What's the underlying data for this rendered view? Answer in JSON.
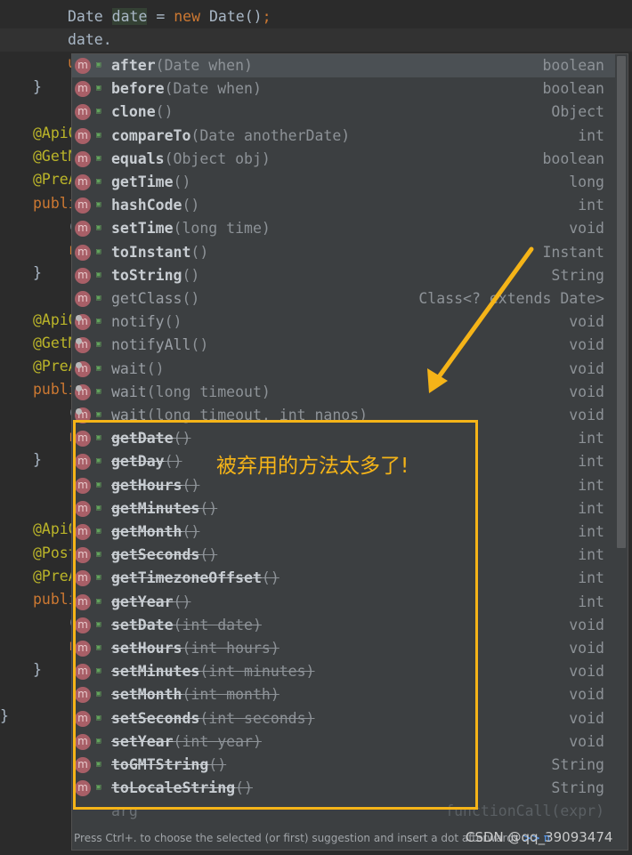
{
  "editor": {
    "lines": [
      {
        "indent": 76,
        "text": "Date date = new Date();",
        "style": "code"
      },
      {
        "indent": 76,
        "text": "date.",
        "style": "code"
      },
      {
        "indent": 76,
        "text": "u",
        "style": "kw"
      },
      {
        "indent": 37,
        "text": "}",
        "style": "code"
      },
      {
        "indent": 37,
        "text": "",
        "style": "code"
      },
      {
        "indent": 37,
        "text": "@ApiO",
        "style": "ann"
      },
      {
        "indent": 37,
        "text": "@GetM",
        "style": "ann"
      },
      {
        "indent": 37,
        "text": "@PreA",
        "style": "ann"
      },
      {
        "indent": 37,
        "text": "publi",
        "style": "kw"
      },
      {
        "indent": 76,
        "text": "(",
        "style": "code"
      },
      {
        "indent": 76,
        "text": "r",
        "style": "kw"
      },
      {
        "indent": 37,
        "text": "}",
        "style": "code"
      },
      {
        "indent": 37,
        "text": "",
        "style": "code"
      },
      {
        "indent": 37,
        "text": "@ApiO",
        "style": "ann"
      },
      {
        "indent": 37,
        "text": "@GetM",
        "style": "ann"
      },
      {
        "indent": 37,
        "text": "@PreA",
        "style": "ann"
      },
      {
        "indent": 37,
        "text": "publi",
        "style": "kw"
      },
      {
        "indent": 76,
        "text": "(",
        "style": "code"
      },
      {
        "indent": 76,
        "text": "r",
        "style": "kw"
      },
      {
        "indent": 37,
        "text": "}",
        "style": "code"
      },
      {
        "indent": 37,
        "text": "",
        "style": "code"
      },
      {
        "indent": 37,
        "text": "",
        "style": "code"
      },
      {
        "indent": 37,
        "text": "@ApiO",
        "style": "ann"
      },
      {
        "indent": 37,
        "text": "@Post",
        "style": "ann"
      },
      {
        "indent": 37,
        "text": "@PreA",
        "style": "ann"
      },
      {
        "indent": 37,
        "text": "publi",
        "style": "kw"
      },
      {
        "indent": 76,
        "text": "(",
        "style": "code"
      },
      {
        "indent": 76,
        "text": "r",
        "style": "kw"
      },
      {
        "indent": 37,
        "text": "}",
        "style": "code"
      },
      {
        "indent": 37,
        "text": "",
        "style": "code"
      },
      {
        "indent": 0,
        "text": "}",
        "style": "code"
      }
    ]
  },
  "completion": {
    "icon_letter": "m",
    "items": [
      {
        "name": "after",
        "params": "(Date when)",
        "type": "boolean",
        "own": true,
        "deprecated": false,
        "selected": true
      },
      {
        "name": "before",
        "params": "(Date when)",
        "type": "boolean",
        "own": true,
        "deprecated": false
      },
      {
        "name": "clone",
        "params": "()",
        "type": "Object",
        "own": true,
        "deprecated": false
      },
      {
        "name": "compareTo",
        "params": "(Date anotherDate)",
        "type": "int",
        "own": true,
        "deprecated": false
      },
      {
        "name": "equals",
        "params": "(Object obj)",
        "type": "boolean",
        "own": true,
        "deprecated": false
      },
      {
        "name": "getTime",
        "params": "()",
        "type": "long",
        "own": true,
        "deprecated": false
      },
      {
        "name": "hashCode",
        "params": "()",
        "type": "int",
        "own": true,
        "deprecated": false
      },
      {
        "name": "setTime",
        "params": "(long time)",
        "type": "void",
        "own": true,
        "deprecated": false
      },
      {
        "name": "toInstant",
        "params": "()",
        "type": "Instant",
        "own": true,
        "deprecated": false
      },
      {
        "name": "toString",
        "params": "()",
        "type": "String",
        "own": true,
        "deprecated": false
      },
      {
        "name": "getClass",
        "params": "()",
        "type": "Class<? extends Date>",
        "own": false,
        "deprecated": false
      },
      {
        "name": "notify",
        "params": "()",
        "type": "void",
        "own": false,
        "deprecated": false,
        "native": true
      },
      {
        "name": "notifyAll",
        "params": "()",
        "type": "void",
        "own": false,
        "deprecated": false,
        "native": true
      },
      {
        "name": "wait",
        "params": "()",
        "type": "void",
        "own": false,
        "deprecated": false,
        "native": true
      },
      {
        "name": "wait",
        "params": "(long timeout)",
        "type": "void",
        "own": false,
        "deprecated": false,
        "native": true
      },
      {
        "name": "wait",
        "params": "(long timeout, int nanos)",
        "type": "void",
        "own": false,
        "deprecated": false,
        "native": true
      },
      {
        "name": "getDate",
        "params": "()",
        "type": "int",
        "own": true,
        "deprecated": true
      },
      {
        "name": "getDay",
        "params": "()",
        "type": "int",
        "own": true,
        "deprecated": true
      },
      {
        "name": "getHours",
        "params": "()",
        "type": "int",
        "own": true,
        "deprecated": true
      },
      {
        "name": "getMinutes",
        "params": "()",
        "type": "int",
        "own": true,
        "deprecated": true
      },
      {
        "name": "getMonth",
        "params": "()",
        "type": "int",
        "own": true,
        "deprecated": true
      },
      {
        "name": "getSeconds",
        "params": "()",
        "type": "int",
        "own": true,
        "deprecated": true
      },
      {
        "name": "getTimezoneOffset",
        "params": "()",
        "type": "int",
        "own": true,
        "deprecated": true
      },
      {
        "name": "getYear",
        "params": "()",
        "type": "int",
        "own": true,
        "deprecated": true
      },
      {
        "name": "setDate",
        "params": "(int date)",
        "type": "void",
        "own": true,
        "deprecated": true
      },
      {
        "name": "setHours",
        "params": "(int hours)",
        "type": "void",
        "own": true,
        "deprecated": true
      },
      {
        "name": "setMinutes",
        "params": "(int minutes)",
        "type": "void",
        "own": true,
        "deprecated": true
      },
      {
        "name": "setMonth",
        "params": "(int month)",
        "type": "void",
        "own": true,
        "deprecated": true
      },
      {
        "name": "setSeconds",
        "params": "(int seconds)",
        "type": "void",
        "own": true,
        "deprecated": true
      },
      {
        "name": "setYear",
        "params": "(int year)",
        "type": "void",
        "own": true,
        "deprecated": true
      },
      {
        "name": "toGMTString",
        "params": "()",
        "type": "String",
        "own": true,
        "deprecated": true
      },
      {
        "name": "toLocaleString",
        "params": "()",
        "type": "String",
        "own": true,
        "deprecated": true
      }
    ],
    "template_item": {
      "name": "arg",
      "type": "functionCall(expr)"
    },
    "footer_text": "Press Ctrl+. to choose the selected (or first) suggestion and insert a dot afterwards",
    "footer_link": ">>",
    "footer_pi": "π"
  },
  "annotation": {
    "note": "被弃用的方法太多了!",
    "color": "#f5b418"
  },
  "watermark": "CSDN @qq_39093474"
}
